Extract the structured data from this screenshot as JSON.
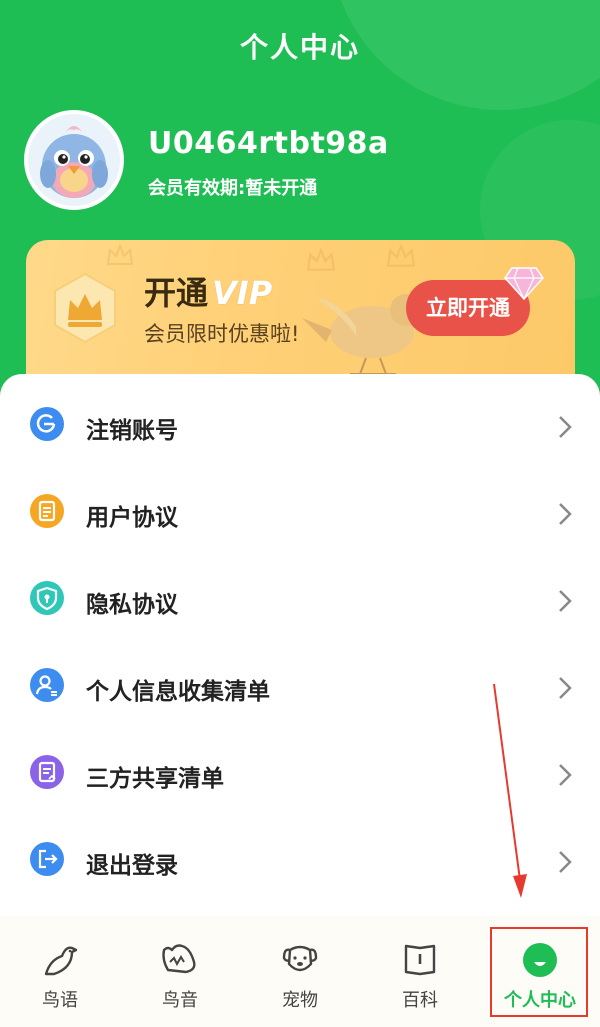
{
  "header": {
    "title": "个人中心"
  },
  "user": {
    "username": "U0464rtbt98a",
    "member_status": "会员有效期:暂未开通"
  },
  "vip": {
    "title_prefix": "开通",
    "title_vip": "VIP",
    "subtitle": "会员限时优惠啦!",
    "button_label": "立即开通"
  },
  "menu": {
    "items": [
      {
        "label": "注销账号",
        "icon": "power-circle-icon",
        "color": "#3d8cf0"
      },
      {
        "label": "用户协议",
        "icon": "document-icon",
        "color": "#f5a623"
      },
      {
        "label": "隐私协议",
        "icon": "shield-icon",
        "color": "#2ec7b8"
      },
      {
        "label": "个人信息收集清单",
        "icon": "user-list-icon",
        "color": "#3d8cf0"
      },
      {
        "label": "三方共享清单",
        "icon": "share-list-icon",
        "color": "#8a63e8"
      },
      {
        "label": "退出登录",
        "icon": "logout-icon",
        "color": "#3d8cf0"
      }
    ]
  },
  "tabbar": {
    "tabs": [
      {
        "label": "鸟语",
        "icon": "bird-icon"
      },
      {
        "label": "鸟音",
        "icon": "bird-sound-icon"
      },
      {
        "label": "宠物",
        "icon": "dog-icon"
      },
      {
        "label": "百科",
        "icon": "book-icon"
      },
      {
        "label": "个人中心",
        "icon": "profile-icon",
        "active": true
      }
    ]
  },
  "colors": {
    "brand": "#1fbe55",
    "vip_button": "#e95248",
    "annotation": "#e63a2e"
  }
}
